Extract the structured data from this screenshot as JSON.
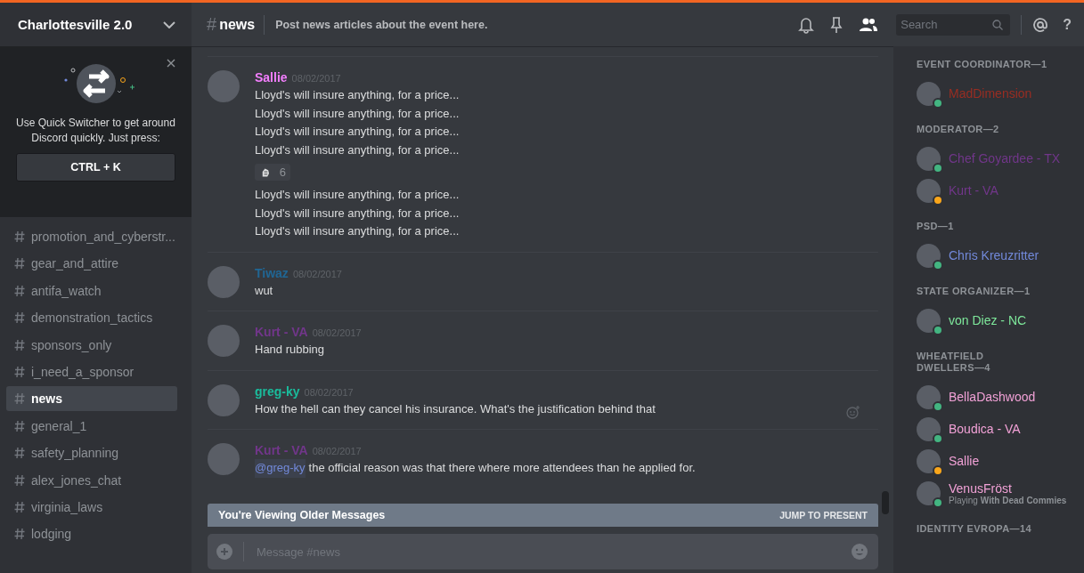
{
  "server": {
    "name": "Charlottesville 2.0"
  },
  "quick_switcher": {
    "text": "Use Quick Switcher to get around Discord quickly. Just press:",
    "shortcut": "CTRL + K"
  },
  "channels": [
    {
      "name": "promotion_and_cyberstr...",
      "selected": false
    },
    {
      "name": "gear_and_attire",
      "selected": false
    },
    {
      "name": "antifa_watch",
      "selected": false
    },
    {
      "name": "demonstration_tactics",
      "selected": false
    },
    {
      "name": "sponsors_only",
      "selected": false
    },
    {
      "name": "i_need_a_sponsor",
      "selected": false
    },
    {
      "name": "news",
      "selected": true
    },
    {
      "name": "general_1",
      "selected": false
    },
    {
      "name": "safety_planning",
      "selected": false
    },
    {
      "name": "alex_jones_chat",
      "selected": false
    },
    {
      "name": "virginia_laws",
      "selected": false
    },
    {
      "name": "lodging",
      "selected": false
    }
  ],
  "header": {
    "hash": "#",
    "channel": "news",
    "topic": "Post news articles about the event here.",
    "search_placeholder": "Search",
    "help": "?"
  },
  "messages": [
    {
      "author": "Sallie",
      "color": "#f47fff",
      "date": "08/02/2017",
      "lines": [
        {
          "kind": "text",
          "text": "Lloyd's will insure anything, for a price..."
        },
        {
          "kind": "text",
          "text": "Lloyd's will insure anything, for a price..."
        },
        {
          "kind": "text",
          "text": "Lloyd's will insure anything, for a price..."
        },
        {
          "kind": "text",
          "text": "Lloyd's will insure anything, for a price..."
        },
        {
          "kind": "reaction",
          "count": "6"
        },
        {
          "kind": "text",
          "text": "Lloyd's will insure anything, for a price..."
        },
        {
          "kind": "text",
          "text": "Lloyd's will insure anything, for a price..."
        },
        {
          "kind": "text",
          "text": "Lloyd's will insure anything, for a price..."
        }
      ]
    },
    {
      "author": "Tiwaz",
      "color": "#206694",
      "date": "08/02/2017",
      "lines": [
        {
          "kind": "text",
          "text": "wut"
        }
      ]
    },
    {
      "author": "Kurt - VA",
      "color": "#71368a",
      "date": "08/02/2017",
      "lines": [
        {
          "kind": "text",
          "text": "Hand rubbing"
        }
      ]
    },
    {
      "author": "greg-ky",
      "color": "#1abc9c",
      "date": "08/02/2017",
      "lines": [
        {
          "kind": "text",
          "text": "How the hell can they cancel his insurance. What's the justification behind that"
        }
      ]
    },
    {
      "author": "Kurt - VA",
      "color": "#71368a",
      "date": "08/02/2017",
      "lines": [
        {
          "kind": "mention",
          "mention": "@greg-ky",
          "text": "the official reason was that there where more attendees than he applied for."
        }
      ]
    }
  ],
  "older_bar": {
    "text": "You're Viewing Older Messages",
    "action": "JUMP TO PRESENT"
  },
  "composer": {
    "placeholder": "Message #news"
  },
  "member_groups": [
    {
      "title": "EVENT COORDINATOR—1",
      "members": [
        {
          "name": "MadDimension",
          "color": "#992d22",
          "status": {
            "color": "#43b581"
          }
        }
      ]
    },
    {
      "title": "MODERATOR—2",
      "members": [
        {
          "name": "Chef Goyardee - TX",
          "color": "#71368a",
          "status": {
            "color": "#43b581"
          }
        },
        {
          "name": "Kurt - VA",
          "color": "#71368a",
          "status": {
            "color": "#faa61a"
          }
        }
      ]
    },
    {
      "title": "PSD—1",
      "members": [
        {
          "name": "Chris Kreuzritter",
          "color": "#7289da",
          "status": {
            "color": "#43b581"
          }
        }
      ]
    },
    {
      "title": "STATE ORGANIZER—1",
      "members": [
        {
          "name": "von Diez - NC",
          "color": "#7ee89b",
          "status": {
            "color": "#43b581"
          }
        }
      ]
    },
    {
      "title": "WHEATFIELD DWELLERS—4",
      "members": [
        {
          "name": "BellaDashwood",
          "color": "#f1a1d6",
          "status": {
            "color": "#43b581"
          }
        },
        {
          "name": "Boudica - VA",
          "color": "#f1a1d6",
          "status": {
            "color": "#43b581"
          }
        },
        {
          "name": "Sallie",
          "color": "#f1a1d6",
          "status": {
            "color": "#faa61a"
          }
        },
        {
          "name": "VenusFröst",
          "color": "#f1a1d6",
          "status": {
            "color": "#43b581"
          },
          "activity_prefix": "Playing",
          "activity": "With Dead Commies"
        }
      ]
    },
    {
      "title": "IDENTITY EVROPA—14"
    }
  ]
}
